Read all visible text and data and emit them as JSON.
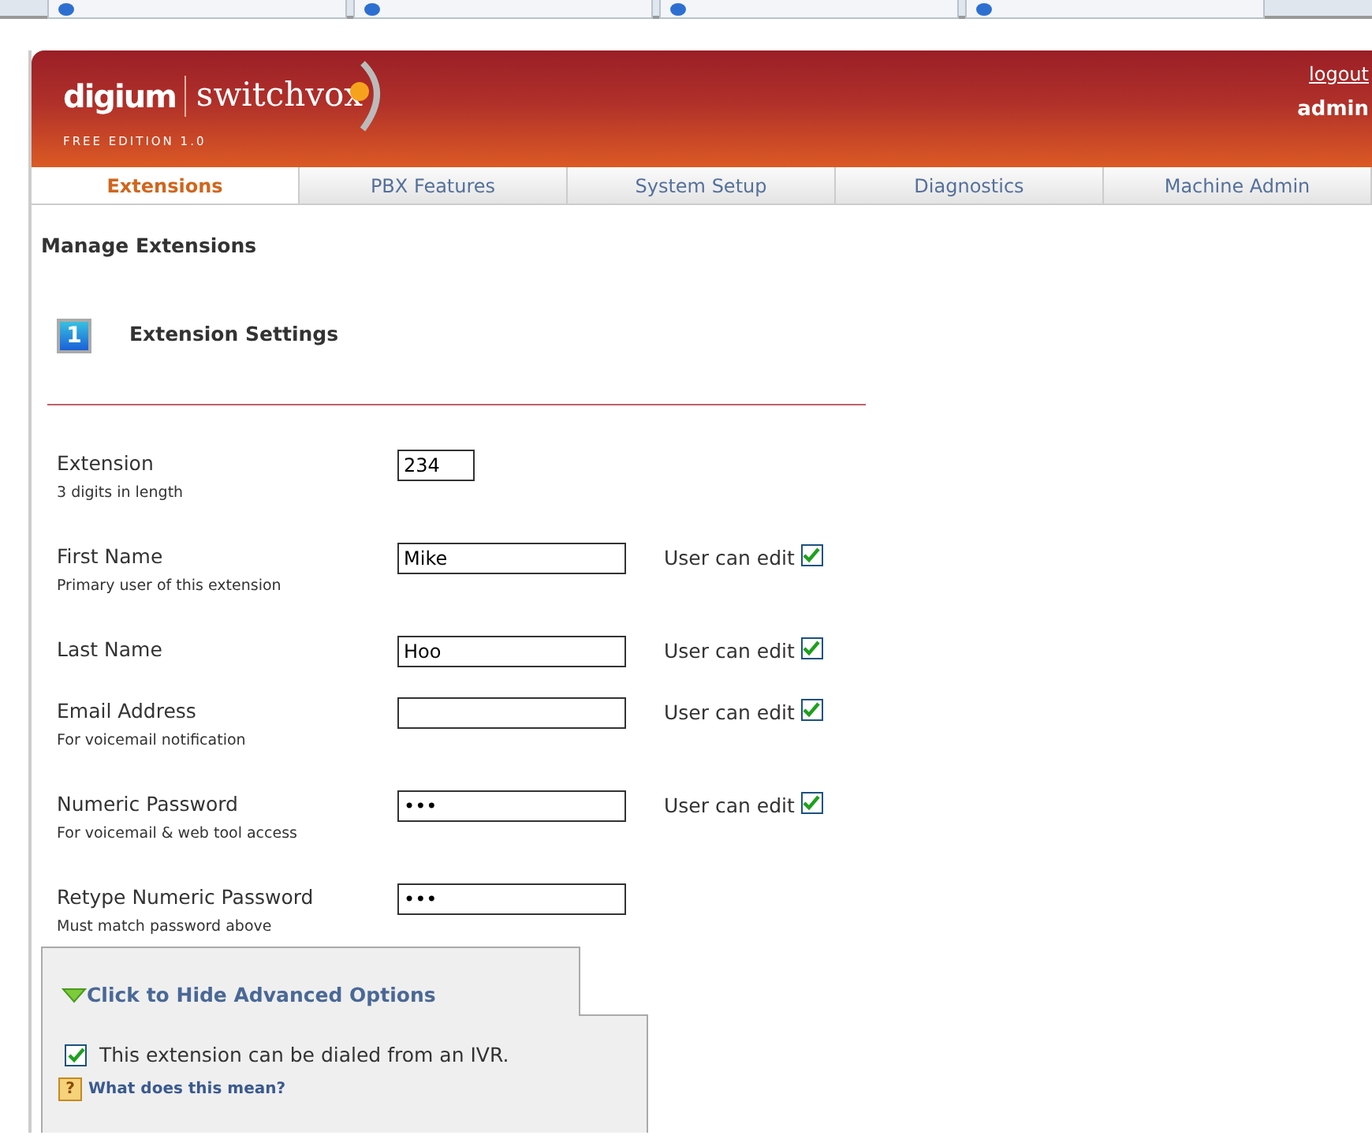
{
  "header": {
    "brand": "digium",
    "product": "switchvox",
    "edition": "FREE EDITION 1.0",
    "logout": "logout",
    "user": "admin"
  },
  "tabs": [
    {
      "label": "Extensions",
      "selected": true
    },
    {
      "label": "PBX Features",
      "selected": false
    },
    {
      "label": "System Setup",
      "selected": false
    },
    {
      "label": "Diagnostics",
      "selected": false
    },
    {
      "label": "Machine Admin",
      "selected": false
    }
  ],
  "page_title": "Manage Extensions",
  "section": {
    "step": "1",
    "title": "Extension Settings"
  },
  "fields": [
    {
      "label": "Extension",
      "hint": "3 digits in length",
      "value": "234",
      "kind": "short"
    },
    {
      "label": "First Name",
      "hint": "Primary user of this extension",
      "value": "Mike",
      "kind": "long",
      "user_can_edit": {
        "label": "User can edit",
        "checked": true
      }
    },
    {
      "label": "Last Name",
      "value": "Hoo",
      "kind": "long",
      "user_can_edit": {
        "label": "User can edit",
        "checked": true
      }
    },
    {
      "label": "Email Address",
      "hint": "For voicemail notification",
      "kind": "long",
      "user_can_edit": {
        "label": "User can edit",
        "checked": true
      }
    },
    {
      "label": "Numeric Password",
      "hint": "For voicemail & web tool access",
      "value": "•••",
      "kind": "long",
      "user_can_edit": {
        "label": "User can edit",
        "checked": true
      }
    },
    {
      "label": "Retype Numeric Password",
      "hint": "Must match password above",
      "value": "•••",
      "kind": "long"
    }
  ],
  "advanced": {
    "toggle": "Click to Hide Advanced Options",
    "expanded": true,
    "option": {
      "label": "This extension can be dialed from an IVR.",
      "checked": true
    },
    "help_icon": "?",
    "help": "What does this mean?"
  }
}
